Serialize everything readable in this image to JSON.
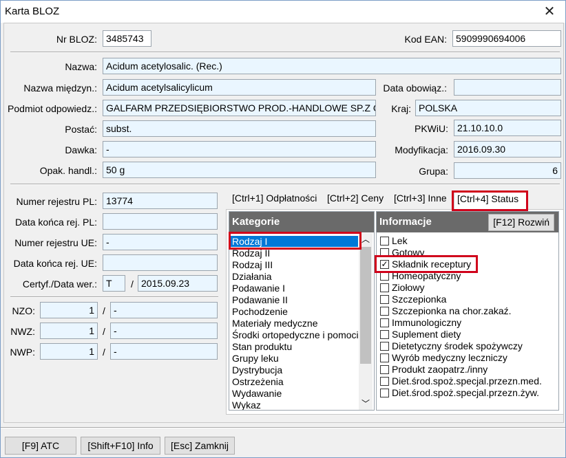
{
  "window": {
    "title": "Karta BLOZ",
    "close_glyph": "✕"
  },
  "fields": {
    "nr_bloz": {
      "label": "Nr BLOZ:",
      "value": "3485743"
    },
    "kod_ean": {
      "label": "Kod EAN:",
      "value": "5909990694006"
    },
    "nazwa": {
      "label": "Nazwa:",
      "value": "Acidum acetylosalic. (Rec.)"
    },
    "nazwa_miedzyn": {
      "label": "Nazwa międzyn.:",
      "value": "Acidum acetylsalicylicum"
    },
    "data_obowiaz": {
      "label": "Data obowiąz.:",
      "value": ""
    },
    "podmiot": {
      "label": "Podmiot odpowiedz.:",
      "value": "GALFARM PRZEDSIĘBIORSTWO PROD.-HANDLOWE SP.Z O.O."
    },
    "kraj": {
      "label": "Kraj:",
      "value": "POLSKA"
    },
    "postac": {
      "label": "Postać:",
      "value": "subst."
    },
    "pkwiu": {
      "label": "PKWiU:",
      "value": "21.10.10.0"
    },
    "dawka": {
      "label": "Dawka:",
      "value": "-"
    },
    "modyfikacja": {
      "label": "Modyfikacja:",
      "value": "2016.09.30"
    },
    "opak": {
      "label": "Opak. handl.:",
      "value": "50 g"
    },
    "grupa": {
      "label": "Grupa:",
      "value": "6"
    },
    "numer_rej_pl": {
      "label": "Numer rejestru PL:",
      "value": "13774"
    },
    "data_konca_pl": {
      "label": "Data końca rej. PL:",
      "value": ""
    },
    "numer_rej_ue": {
      "label": "Numer rejestru UE:",
      "value": "-"
    },
    "data_konca_ue": {
      "label": "Data końca rej. UE:",
      "value": ""
    },
    "certyf": {
      "label": "Certyf./Data wer.:",
      "value": "T",
      "slash": "/",
      "date": "2015.09.23"
    },
    "nzo": {
      "label": "NZO:",
      "value": "1",
      "slash": "/",
      "value2": "-"
    },
    "nwz": {
      "label": "NWZ:",
      "value": "1",
      "slash": "/",
      "value2": "-"
    },
    "nwp": {
      "label": "NWP:",
      "value": "1",
      "slash": "/",
      "value2": "-"
    }
  },
  "tabs": [
    {
      "label": "[Ctrl+1] Odpłatności"
    },
    {
      "label": "[Ctrl+2] Ceny"
    },
    {
      "label": "[Ctrl+3] Inne"
    },
    {
      "label": "[Ctrl+4] Status"
    }
  ],
  "kategorie": {
    "header": "Kategorie",
    "items": [
      "Rodzaj I",
      "Rodzaj II",
      "Rodzaj III",
      "Działania",
      "Podawanie I",
      "Podawanie II",
      "Pochodzenie",
      "Materiały medyczne",
      "Środki ortopedyczne i pomoci",
      "Stan produktu",
      "Grupy leku",
      "Dystrybucja",
      "Ostrzeżenia",
      "Wydawanie",
      "Wykaz"
    ],
    "selected": "Rodzaj I"
  },
  "informacje": {
    "header": "Informacje",
    "expand_button": "[F12] Rozwiń",
    "items": [
      {
        "label": "Lek",
        "checked": false
      },
      {
        "label": "Gotowy",
        "checked": false
      },
      {
        "label": "Składnik receptury",
        "checked": true
      },
      {
        "label": "Homeopatyczny",
        "checked": false
      },
      {
        "label": "Ziołowy",
        "checked": false
      },
      {
        "label": "Szczepionka",
        "checked": false
      },
      {
        "label": "Szczepionka na chor.zakaź.",
        "checked": false
      },
      {
        "label": "Immunologiczny",
        "checked": false
      },
      {
        "label": "Suplement diety",
        "checked": false
      },
      {
        "label": "Dietetyczny środek spożywczy",
        "checked": false
      },
      {
        "label": "Wyrób medyczny leczniczy",
        "checked": false
      },
      {
        "label": "Produkt zaopatrz./inny",
        "checked": false
      },
      {
        "label": "Diet.środ.spoż.specjal.przezn.med.",
        "checked": false
      },
      {
        "label": "Diet.środ.spoż.specjal.przezn.żyw.",
        "checked": false
      }
    ]
  },
  "buttons": {
    "atc": "[F9] ATC",
    "info": "[Shift+F10] Info",
    "close": "[Esc] Zamknij"
  },
  "scroll": {
    "up": "︿",
    "down": "﹀"
  },
  "check_glyph": "✓",
  "colors": {
    "highlight": "#d0021b",
    "selection": "#0078d7",
    "field_bg": "#eaf6ff",
    "header_bg": "#6a6a6a"
  }
}
